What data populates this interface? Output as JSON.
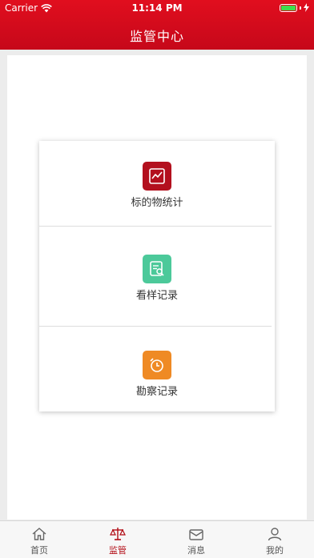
{
  "status_bar": {
    "carrier": "Carrier",
    "time": "11:14 PM"
  },
  "header": {
    "title": "监管中心"
  },
  "menu": {
    "items": [
      {
        "label": "标的物统计",
        "icon": "line-chart-icon",
        "color": "#b3101e"
      },
      {
        "label": "看样记录",
        "icon": "document-search-icon",
        "color": "#4cc99a"
      },
      {
        "label": "勘察记录",
        "icon": "alarm-clock-icon",
        "color": "#ef8a24"
      }
    ]
  },
  "tabbar": {
    "tabs": [
      {
        "label": "首页",
        "icon": "home-icon"
      },
      {
        "label": "监管",
        "icon": "scales-icon",
        "active": true
      },
      {
        "label": "消息",
        "icon": "mail-icon"
      },
      {
        "label": "我的",
        "icon": "user-icon"
      }
    ]
  },
  "colors": {
    "brand": "#d20b1b",
    "active_tab": "#b20b14"
  }
}
